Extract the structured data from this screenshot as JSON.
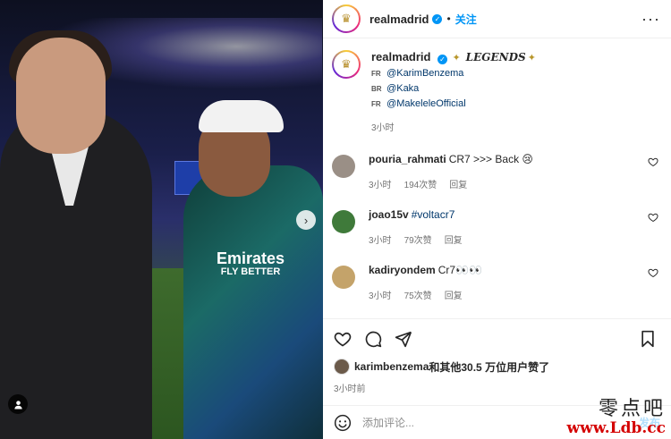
{
  "post": {
    "username": "realmadrid",
    "follow_label": "关注",
    "dot": "•",
    "more_label": "···",
    "caption": {
      "username": "realmadrid",
      "legend_text": "LEGENDS",
      "mentions": [
        {
          "flag": "FR",
          "handle": "@KarimBenzema"
        },
        {
          "flag": "BR",
          "handle": "@Kaka"
        },
        {
          "flag": "FR",
          "handle": "@MakeleleOfficial"
        }
      ],
      "time": "3小时"
    },
    "comments": [
      {
        "user": "pouria_rahmati",
        "text": "CR7 >>> Back 😢",
        "time": "3小时",
        "likes": "194次赞",
        "reply": "回复",
        "avatar_color": "#9a8f86"
      },
      {
        "user": "joao15v",
        "text": "#voltacr7",
        "time": "3小时",
        "likes": "79次赞",
        "reply": "回复",
        "avatar_color": "#3f7a3a"
      },
      {
        "user": "kadiryondem",
        "text": "Cr7👀👀",
        "time": "3小时",
        "likes": "75次赞",
        "reply": "回复",
        "avatar_color": "#c4a36a"
      }
    ],
    "liked_by": {
      "user": "karimbenzema",
      "rest": "和其他30.5 万位用户赞了"
    },
    "post_time": "3小时前",
    "comment_input": {
      "placeholder": "添加评论..."
    },
    "post_button": "发布"
  },
  "photo": {
    "jersey_line1": "Emirates",
    "jersey_line2": "FLY BETTER"
  },
  "watermark": {
    "line1": "零点吧",
    "line2": "www.Ldb.cc"
  },
  "colors": {
    "accent": "#0095f6",
    "verified": "#0095f6",
    "mention": "#00376b",
    "watermark_red": "#d40000"
  }
}
